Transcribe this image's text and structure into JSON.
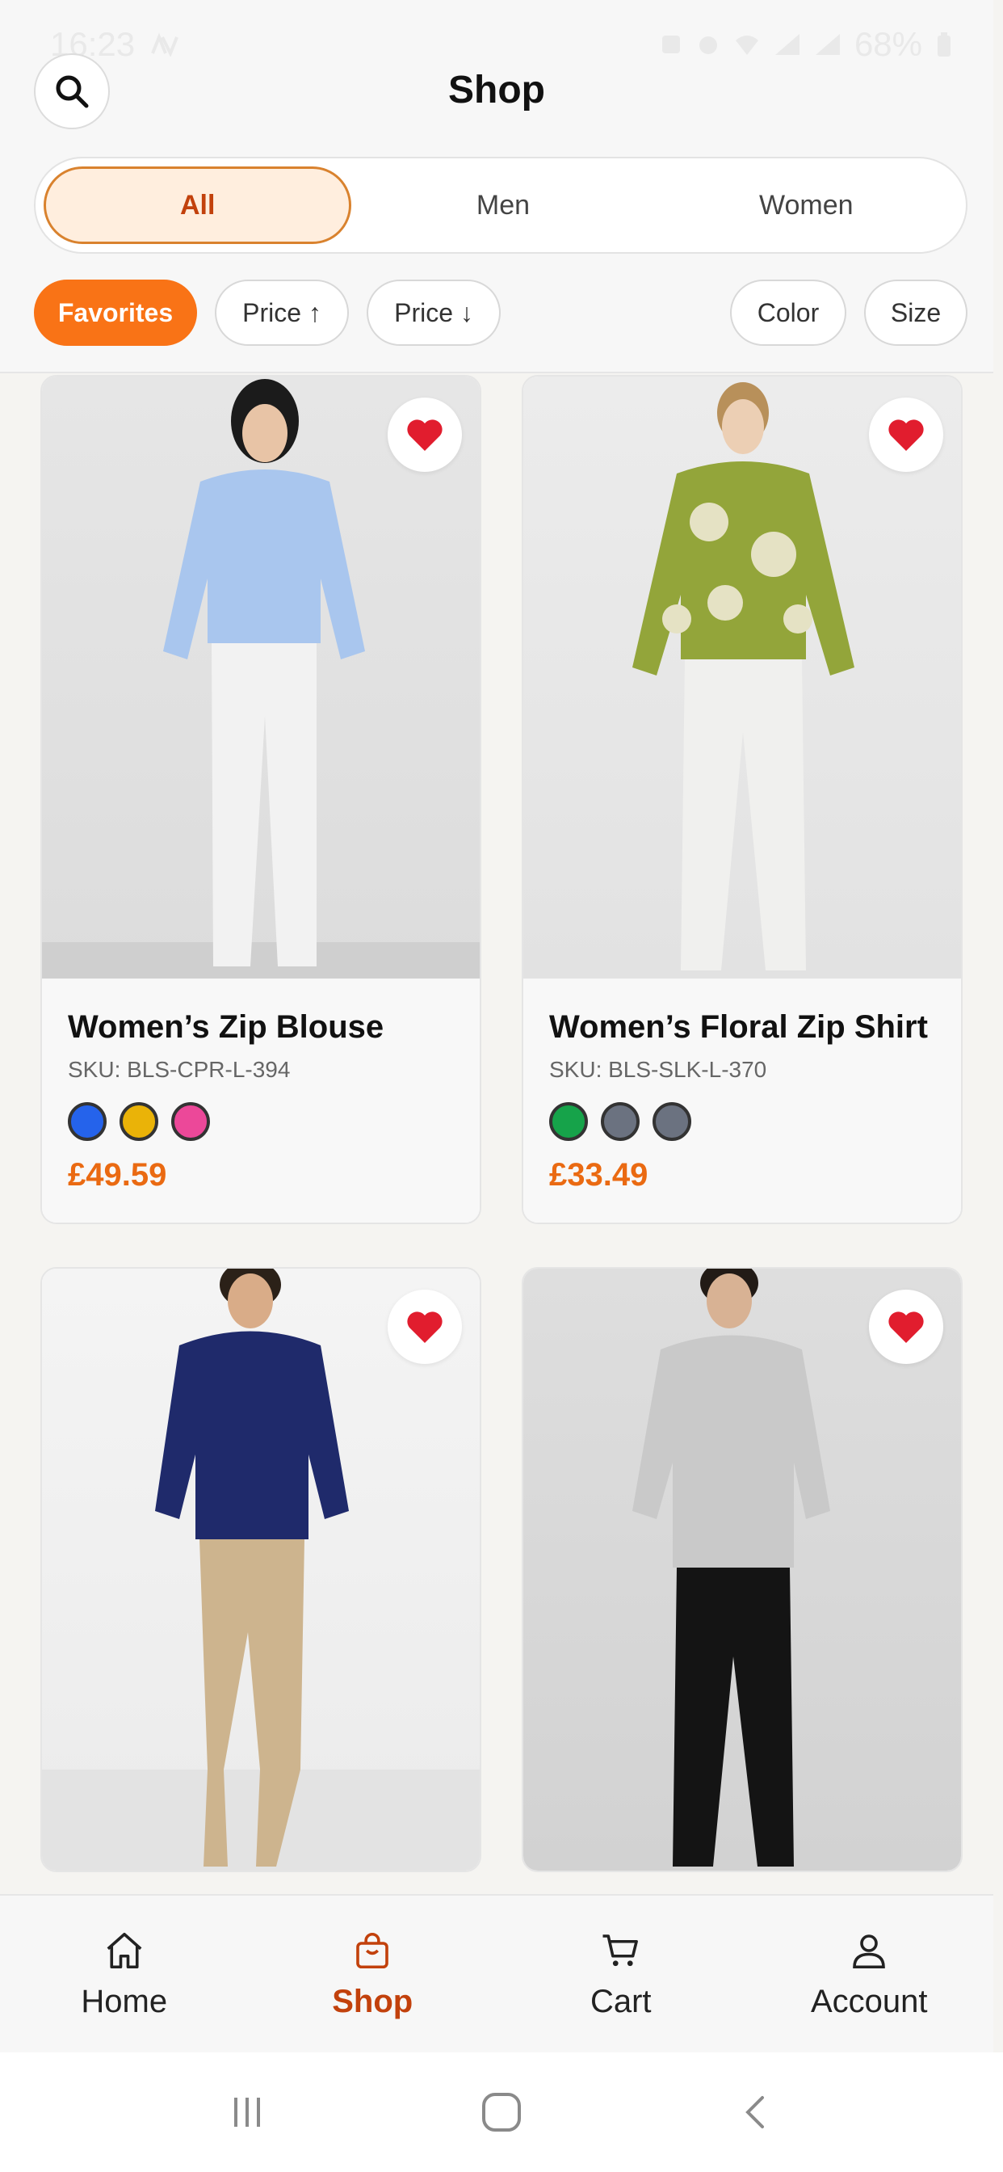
{
  "status_bar": {
    "time": "16:23",
    "battery": "68%"
  },
  "header": {
    "title": "Shop",
    "segments": [
      "All",
      "Men",
      "Women"
    ],
    "active_segment": "All",
    "filters": [
      "Favorites",
      "Price ↑",
      "Price ↓",
      "Color",
      "Size"
    ]
  },
  "products": [
    {
      "name": "Women’s Zip Blouse",
      "sku": "SKU: BLS-CPR-L-394",
      "price": "£49.59",
      "colors": [
        "#2563eb",
        "#eab308",
        "#ec4899"
      ],
      "favorite": true
    },
    {
      "name": "Women’s Floral Zip Shirt",
      "sku": "SKU: BLS-SLK-L-370",
      "price": "£33.49",
      "colors": [
        "#16a34a",
        "#6b7280",
        "#6b7280"
      ],
      "favorite": true
    },
    {
      "name": "",
      "sku": "",
      "price": "",
      "favorite": true
    },
    {
      "name": "",
      "sku": "",
      "price": "",
      "favorite": true
    }
  ],
  "bottom_nav": [
    {
      "label": "Home",
      "icon": "home-icon"
    },
    {
      "label": "Shop",
      "icon": "shopping-bag-icon",
      "active": true
    },
    {
      "label": "Cart",
      "icon": "cart-icon"
    },
    {
      "label": "Account",
      "icon": "user-icon"
    }
  ],
  "colors": {
    "accent": "#f97316",
    "accent_text": "#c2410c",
    "heart": "#e11d2e"
  }
}
